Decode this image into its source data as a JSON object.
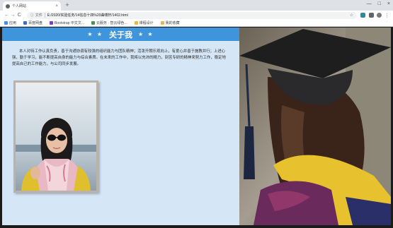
{
  "browser": {
    "tab_title": "个人网站",
    "tab_close": "×",
    "new_tab": "+",
    "window_controls": [
      "—",
      "□",
      "×"
    ],
    "nav_back": "←",
    "nav_forward": "→",
    "nav_reload": "C",
    "not_secure_label": "文件",
    "url": "E:/2020/实验任务/14信息十四%20曲啸轩/1402.html",
    "star": "☆",
    "menu": "⋮"
  },
  "bookmarks": [
    {
      "label": "应用",
      "color": "#4a88f0"
    },
    {
      "label": "百度网盘",
      "color": "#2f6fd6"
    },
    {
      "label": "Bootstrap 中文文...",
      "color": "#7a3ec9"
    },
    {
      "label": "云服务 · 智云绿色...",
      "color": "#3a9a4a"
    },
    {
      "label": "课程设计",
      "color": "#e8b94a"
    },
    {
      "label": "我的收藏",
      "color": "#e8b94a"
    }
  ],
  "page": {
    "heading": "关于我",
    "stars_left": "★ ★",
    "stars_right": "★ ★",
    "intro": "本人对待工作认真负责，善于沟通协调有较强的组织能力与团队精神；活泼开朗乐观向上，有爱心并善于施教并行；上进心强，勤于学习，能不断提高自身的能力与综合素质。在未来的工作中，我将以充沛的精力，刻苦专研的精神来努力工作，稳定地提高自己的工作能力，与公司同步发展。"
  },
  "colors": {
    "banner": "#3f95dc",
    "left_bg": "#d5e6f6"
  }
}
